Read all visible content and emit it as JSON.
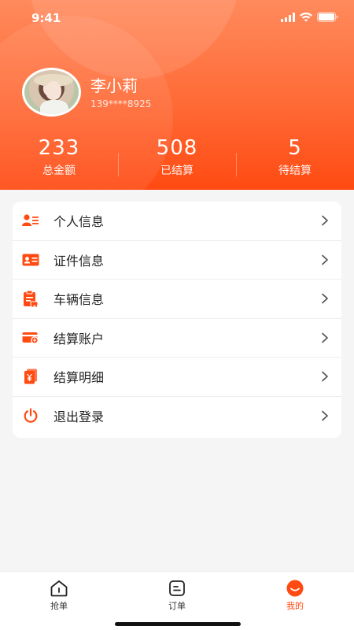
{
  "status_bar": {
    "time": "9:41"
  },
  "profile": {
    "name": "李小莉",
    "phone": "139****8925"
  },
  "stats": [
    {
      "value": "233",
      "label": "总金额"
    },
    {
      "value": "508",
      "label": "已结算"
    },
    {
      "value": "5",
      "label": "待结算"
    }
  ],
  "menu": [
    {
      "label": "个人信息",
      "icon": "person-card-icon"
    },
    {
      "label": "证件信息",
      "icon": "id-card-icon"
    },
    {
      "label": "车辆信息",
      "icon": "vehicle-clipboard-icon"
    },
    {
      "label": "结算账户",
      "icon": "bank-card-icon"
    },
    {
      "label": "结算明细",
      "icon": "yen-bill-icon"
    },
    {
      "label": "退出登录",
      "icon": "power-icon"
    }
  ],
  "tabbar": [
    {
      "label": "抢单",
      "icon": "home-icon"
    },
    {
      "label": "订单",
      "icon": "order-icon"
    },
    {
      "label": "我的",
      "icon": "profile-face-icon",
      "active": true
    }
  ],
  "colors": {
    "accent": "#ff4a12",
    "header_top": "#ff8a5c"
  }
}
